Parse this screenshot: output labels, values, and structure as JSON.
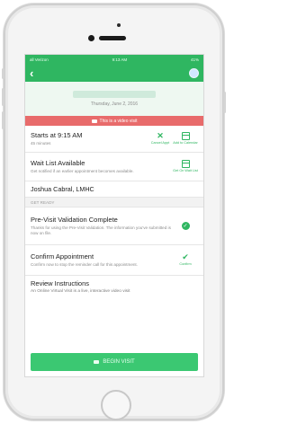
{
  "status_bar": {
    "carrier": "all Verizon",
    "time": "9:13 AM",
    "battery": "41%"
  },
  "nav": {
    "back_icon": "chevron-left-icon",
    "avatar_icon": "avatar-icon"
  },
  "header": {
    "date": "Thursday, June 2, 2016"
  },
  "banner": {
    "text": "This is a video visit",
    "icon": "video-icon",
    "color": "#e86b6b"
  },
  "appointment": {
    "start": "Starts at 9:15 AM",
    "duration": "45 minutes",
    "cancel_label": "Cancel Appt",
    "calendar_label": "Add to Calendar"
  },
  "waitlist": {
    "title": "Wait List Available",
    "subtitle": "Get notified if an earlier appointment becomes available.",
    "action_label": "Get On Wait List"
  },
  "provider": {
    "name": "Joshua Cabral, LMHC"
  },
  "section": {
    "label": "GET READY"
  },
  "validation": {
    "title": "Pre-Visit Validation Complete",
    "subtitle": "Thanks for using the Pre-Visit Validation. The information you've submitted is now on file."
  },
  "confirm": {
    "title": "Confirm Appointment",
    "subtitle": "Confirm now to stop the reminder call for this appointment.",
    "action_label": "Confirm"
  },
  "review": {
    "title": "Review Instructions",
    "text": "An Online Virtual Visit is a live, interactive video visit"
  },
  "cta": {
    "label": "BEGIN VISIT"
  },
  "colors": {
    "brand_green": "#2fb661",
    "button_green": "#3bc872",
    "alert_red": "#e86b6b"
  }
}
